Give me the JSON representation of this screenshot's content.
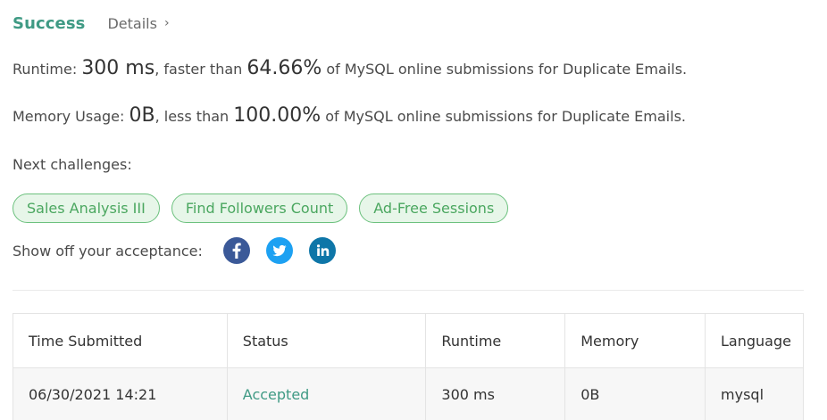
{
  "header": {
    "status_title": "Success",
    "details_link": "Details",
    "details_chevron": "›"
  },
  "runtime_line": {
    "label": "Runtime: ",
    "value": "300 ms",
    "middle": ", faster than ",
    "percent": "64.66%",
    "suffix": " of MySQL online submissions for Duplicate Emails."
  },
  "memory_line": {
    "label": "Memory Usage: ",
    "value": "0B",
    "middle": ", less than ",
    "percent": "100.00%",
    "suffix": " of MySQL online submissions for Duplicate Emails."
  },
  "next_challenges": {
    "label": "Next challenges:",
    "items": [
      "Sales Analysis III",
      "Find Followers Count",
      "Ad-Free Sessions"
    ]
  },
  "share": {
    "label": "Show off your acceptance:",
    "icons": [
      "facebook-icon",
      "twitter-icon",
      "linkedin-icon"
    ]
  },
  "table": {
    "columns": [
      "Time Submitted",
      "Status",
      "Runtime",
      "Memory",
      "Language"
    ],
    "rows": [
      [
        "06/30/2021 14:21",
        "Accepted",
        "300 ms",
        "0B",
        "mysql"
      ]
    ]
  },
  "colors": {
    "accent_green": "#3f9a84",
    "chip_border": "#6cc17e",
    "chip_bg": "#e7f6e9",
    "facebook": "#3b5998",
    "twitter": "#1da1f2",
    "linkedin": "#0e76a8"
  }
}
